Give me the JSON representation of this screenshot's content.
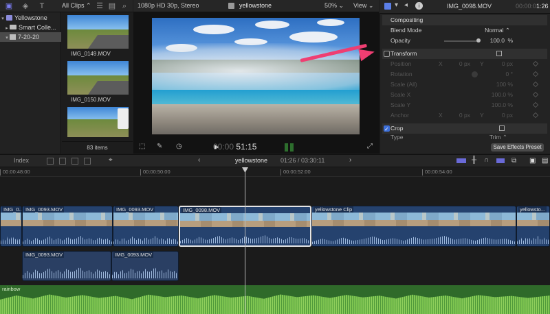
{
  "browser": {
    "clips_filter": "All Clips ⌃",
    "library_items": [
      {
        "label": "Yellowstone"
      },
      {
        "label": "Smart Colle..."
      },
      {
        "label": "7-20-20"
      }
    ],
    "clips": [
      {
        "name": "IMG_0149.MOV"
      },
      {
        "name": "IMG_0150.MOV"
      },
      {
        "name": ""
      }
    ],
    "item_count": "83 items"
  },
  "viewer": {
    "format": "1080p HD 30p, Stereo",
    "title": "yellowstone",
    "zoom": "50% ⌄",
    "view": "View ⌄",
    "timecode_dim": "00:00",
    "timecode": "51:15"
  },
  "inspector": {
    "clip_name": "IMG_0098.MOV",
    "duration_dim": "00:00:0",
    "duration": "1:26",
    "compositing": "Compositing",
    "blend_mode_label": "Blend Mode",
    "blend_mode_value": "Normal ⌃",
    "opacity_label": "Opacity",
    "opacity_value": "100.0",
    "opacity_unit": "%",
    "transform_label": "Transform",
    "position_label": "Position",
    "position_x": "X",
    "position_x_val": "0  px",
    "position_y": "Y",
    "position_y_val": "0  px",
    "rotation_label": "Rotation",
    "rotation_val": "0 °",
    "scale_all_label": "Scale (All)",
    "scale_all_val": "100 %",
    "scale_x_label": "Scale X",
    "scale_x_val": "100.0 %",
    "scale_y_label": "Scale Y",
    "scale_y_val": "100.0 %",
    "anchor_label": "Anchor",
    "anchor_x": "X",
    "anchor_x_val": "0  px",
    "anchor_y": "Y",
    "anchor_y_val": "0  px",
    "crop_label": "Crop",
    "type_label": "Type",
    "type_value": "Trim ⌃",
    "save_preset": "Save Effects Preset"
  },
  "timeline": {
    "index_label": "Index",
    "project_name": "yellowstone",
    "position": "01:26 / 03:30:11",
    "ruler": [
      "00:00:48:00",
      "00:00:50:00",
      "00:00:52:00",
      "00:00:54:00"
    ],
    "clips": [
      {
        "name": "IMG_0..."
      },
      {
        "name": "IMG_0093.MOV"
      },
      {
        "name": "IMG_0093.MOV"
      },
      {
        "name": "IMG_0098.MOV"
      },
      {
        "name": "yellowstone Clip"
      },
      {
        "name": "yellowsto..."
      }
    ],
    "connected_clips": [
      {
        "name": "IMG_0093.MOV"
      },
      {
        "name": "IMG_0093.MOV"
      }
    ],
    "audio_clip": "rainbow"
  },
  "colors": {
    "accent": "#3d6fd8",
    "arrow": "#ef3e72",
    "video_clip": "#25426e",
    "audio_clip": "#2f6a2a"
  }
}
